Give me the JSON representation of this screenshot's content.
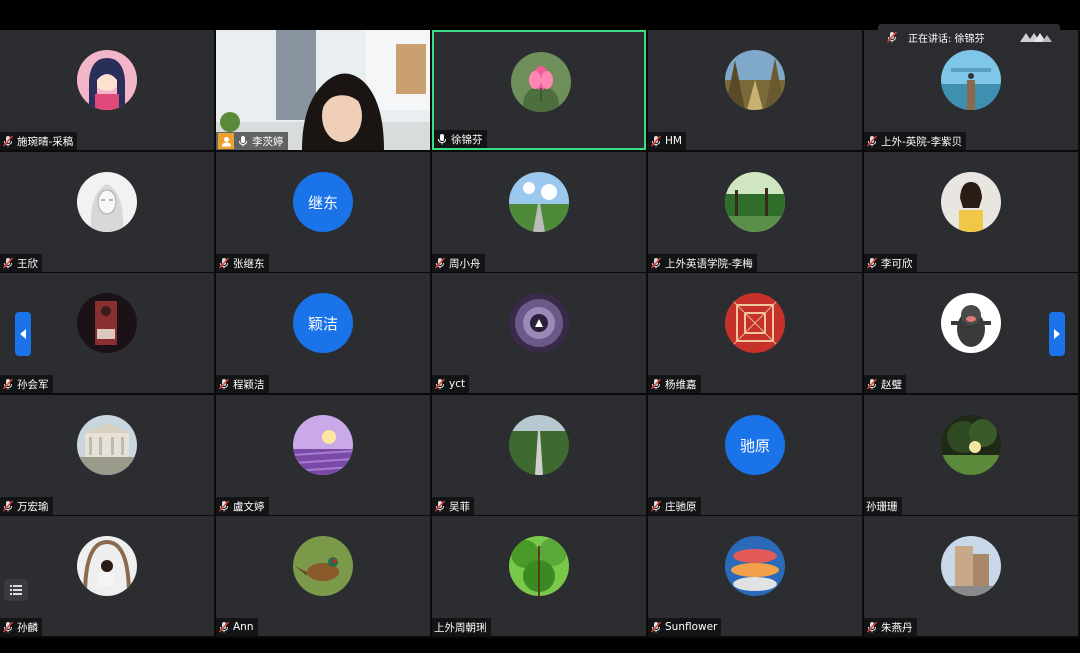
{
  "speaking": {
    "label": "正在讲话: 徐锦芬"
  },
  "colors": {
    "accent": "#1a73e8",
    "active_border": "#3ddc84",
    "tile_bg": "#2c2d30",
    "host_badge": "#f0a030"
  },
  "participants": [
    {
      "name": "施琬晴-采稿",
      "avatar_type": "anime-portrait",
      "mic": "muted"
    },
    {
      "name": "李茨婷",
      "avatar_type": "live-video",
      "mic": "on",
      "host": true
    },
    {
      "name": "徐锦芬",
      "avatar_type": "pink-flower",
      "mic": "on",
      "active": true
    },
    {
      "name": "HM",
      "avatar_type": "forest-path",
      "mic": "muted"
    },
    {
      "name": "上外-英院-李紫贝",
      "avatar_type": "pier-sky",
      "mic": "muted"
    },
    {
      "name": "王欣",
      "avatar_type": "sketch-portrait",
      "mic": "muted"
    },
    {
      "name": "张继东",
      "avatar_type": "initials",
      "initials": "继东",
      "mic": "muted"
    },
    {
      "name": "周小舟",
      "avatar_type": "road-sky",
      "mic": "muted"
    },
    {
      "name": "上外英语学院-李梅",
      "avatar_type": "green-forest",
      "mic": "muted"
    },
    {
      "name": "李可欣",
      "avatar_type": "girl-portrait",
      "mic": "muted"
    },
    {
      "name": "孙会军",
      "avatar_type": "dark-photo",
      "mic": "muted"
    },
    {
      "name": "程颖洁",
      "avatar_type": "initials",
      "initials": "颖洁",
      "mic": "muted"
    },
    {
      "name": "yct",
      "avatar_type": "cosmic-tunnel",
      "mic": "muted"
    },
    {
      "name": "杨维嘉",
      "avatar_type": "red-pattern",
      "mic": "muted"
    },
    {
      "name": "赵璧",
      "avatar_type": "cartoon-mole",
      "mic": "muted"
    },
    {
      "name": "万宏瑜",
      "avatar_type": "museum",
      "mic": "muted"
    },
    {
      "name": "盧文婷",
      "avatar_type": "lavender-field",
      "mic": "muted"
    },
    {
      "name": "吴菲",
      "avatar_type": "green-road",
      "mic": "muted"
    },
    {
      "name": "庄驰原",
      "avatar_type": "initials",
      "initials": "驰原",
      "mic": "muted"
    },
    {
      "name": "孙珊珊",
      "avatar_type": "park-trees",
      "mic": "none"
    },
    {
      "name": "孙麟",
      "avatar_type": "girl-swing",
      "mic": "muted"
    },
    {
      "name": "Ann",
      "avatar_type": "pheasant",
      "mic": "muted"
    },
    {
      "name": "上外周朝琍",
      "avatar_type": "tree-canopy",
      "mic": "none"
    },
    {
      "name": "Sunflower",
      "avatar_type": "fish-art",
      "mic": "muted"
    },
    {
      "name": "朱燕丹",
      "avatar_type": "street-building",
      "mic": "muted"
    }
  ],
  "icons": {
    "mic_muted": "mic-muted-icon",
    "mic_on": "mic-icon",
    "host": "host-icon",
    "prev": "chevron-left-icon",
    "next": "chevron-right-icon",
    "list": "list-icon"
  }
}
